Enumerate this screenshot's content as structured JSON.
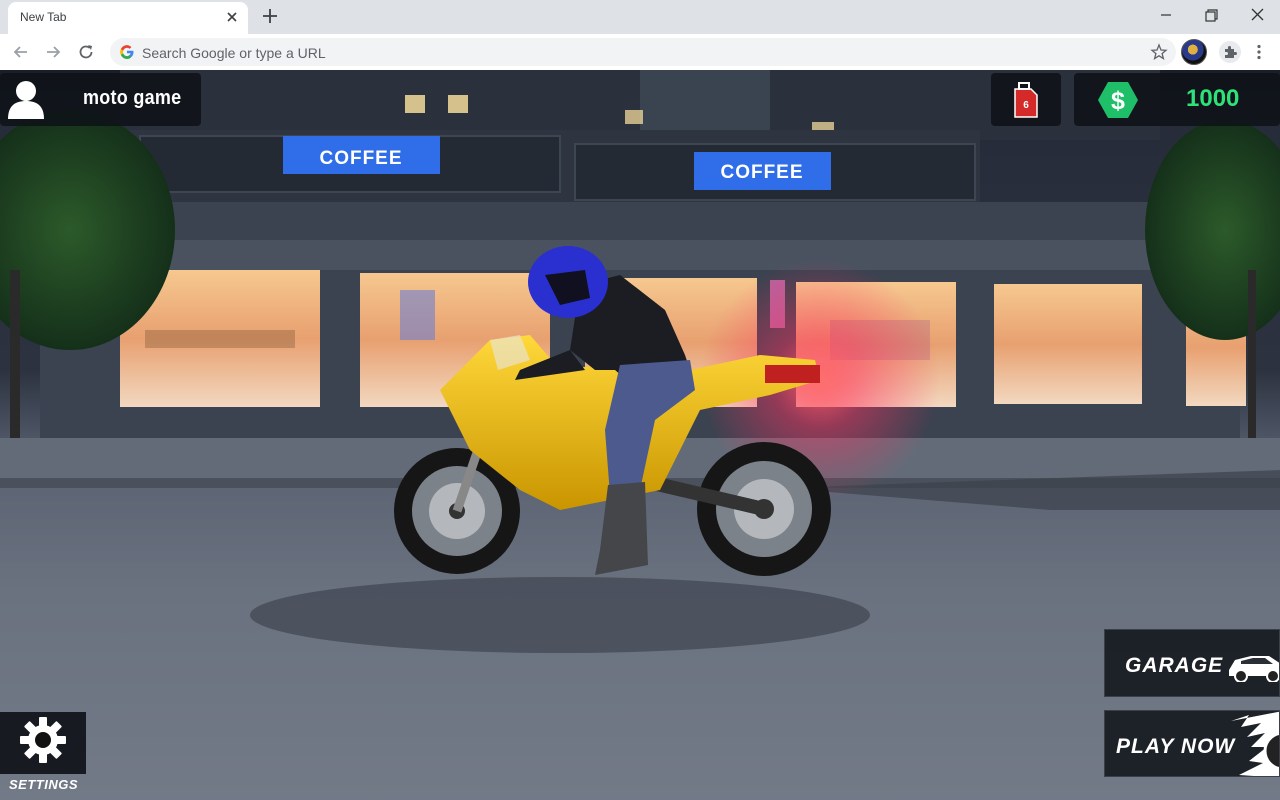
{
  "browser": {
    "tab_title": "New Tab",
    "omnibox_placeholder": "Search Google or type a URL"
  },
  "hud": {
    "player_name": "moto game",
    "money": "1000",
    "fuel_icon": "fuel-can-icon",
    "money_icon": "dollar-hex-icon",
    "money_color": "#2ee27a",
    "fuel_color": "#d42a2a"
  },
  "scene": {
    "signs": [
      "COFFEE",
      "COFFEE"
    ],
    "bike_color": "#e8b600",
    "helmet_color": "#2a2fd0"
  },
  "buttons": {
    "garage": "GARAGE",
    "play_now": "PLAY NOW",
    "settings": "SETTINGS"
  }
}
